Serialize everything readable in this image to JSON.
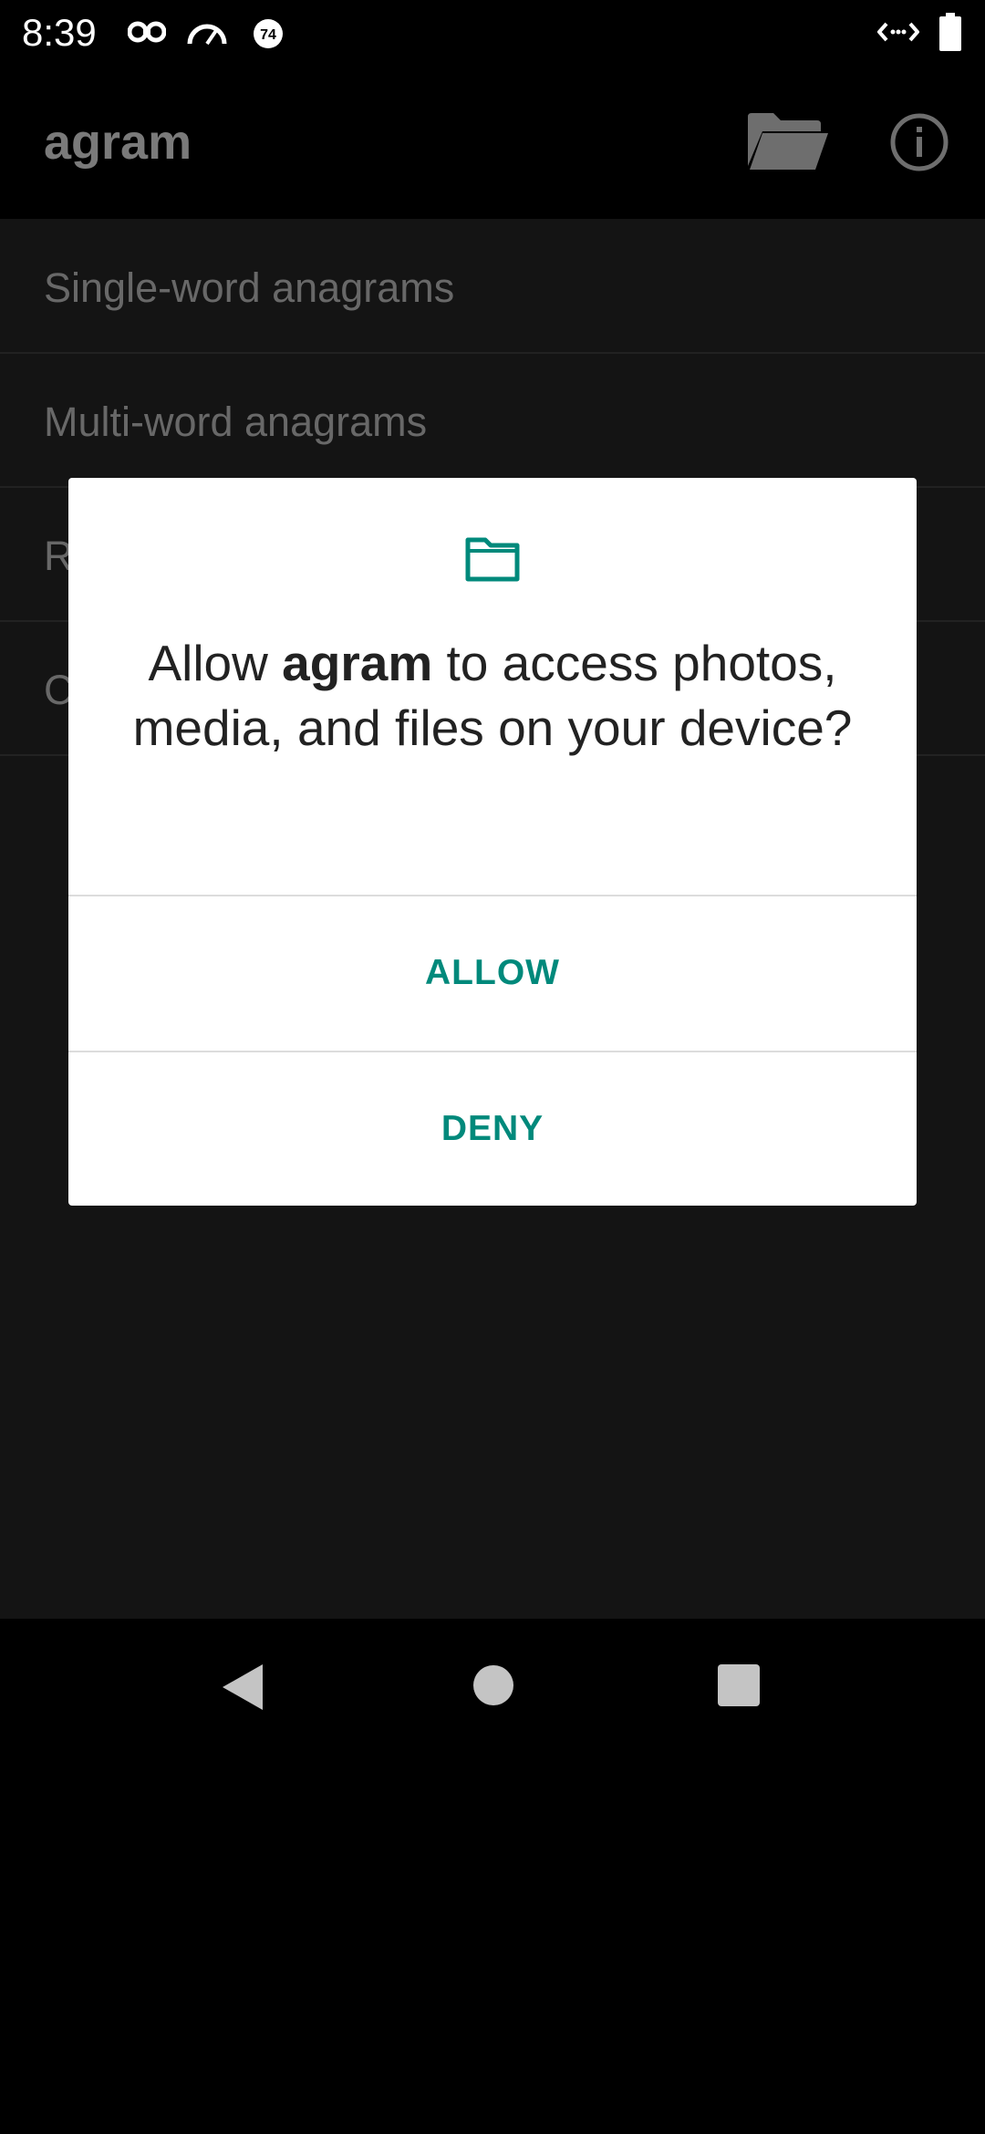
{
  "status_bar": {
    "time": "8:39",
    "icons": [
      "incognito-icon",
      "speedometer-icon",
      "notification-badge-icon",
      "data-transfer-icon",
      "battery-icon"
    ],
    "badge_text": "74"
  },
  "app_bar": {
    "title": "agram",
    "actions": [
      "folder-open-icon",
      "info-icon"
    ]
  },
  "list": {
    "items": [
      {
        "label": "Single-word anagrams"
      },
      {
        "label": "Multi-word anagrams"
      },
      {
        "label": "R"
      },
      {
        "label": "C"
      }
    ]
  },
  "dialog": {
    "icon": "folder-icon",
    "message_prefix": "Allow ",
    "app_name": "agram",
    "message_suffix": " to access photos, media, and files on your device?",
    "allow_label": "ALLOW",
    "deny_label": "DENY",
    "accent_color": "#00897b"
  },
  "nav_bar": {
    "buttons": [
      "back-icon",
      "home-icon",
      "recents-icon"
    ]
  },
  "colors": {
    "content_background": "#141414",
    "scrim_text": "#686868",
    "dialog_background": "#ffffff"
  }
}
